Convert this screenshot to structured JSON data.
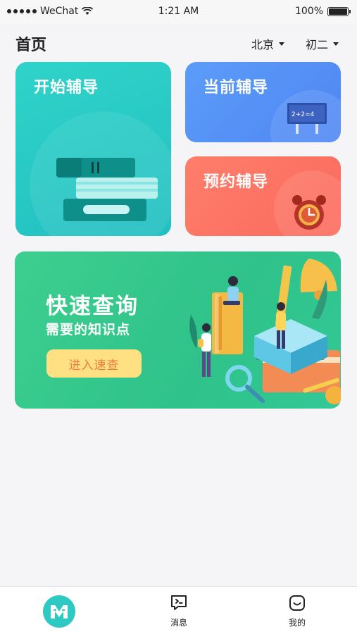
{
  "status_bar": {
    "carrier": "WeChat",
    "time": "1:21 AM",
    "battery": "100%",
    "icons": [
      "signal-dots-icon",
      "wifi-icon",
      "battery-icon"
    ]
  },
  "header": {
    "title": "首页",
    "city": "北京",
    "grade": "初二"
  },
  "cards": {
    "start": {
      "label": "开始辅导",
      "color": "#26c7c4",
      "illustration": "books-stack-icon"
    },
    "current": {
      "label": "当前辅导",
      "color": "#5592f6",
      "illustration": "chalkboard-icon"
    },
    "booking": {
      "label": "预约辅导",
      "color": "#fc7362",
      "illustration": "alarm-clock-icon"
    }
  },
  "banner": {
    "title": "快速查询",
    "subtitle": "需要的知识点",
    "button": "进入速查",
    "color": "#36c98d",
    "button_color": "#ffe083",
    "illustration": "students-books-illustration"
  },
  "tabbar": {
    "items": [
      {
        "icon": "app-logo-icon",
        "label": ""
      },
      {
        "icon": "message-icon",
        "label": "消息"
      },
      {
        "icon": "profile-face-icon",
        "label": "我的"
      }
    ]
  }
}
